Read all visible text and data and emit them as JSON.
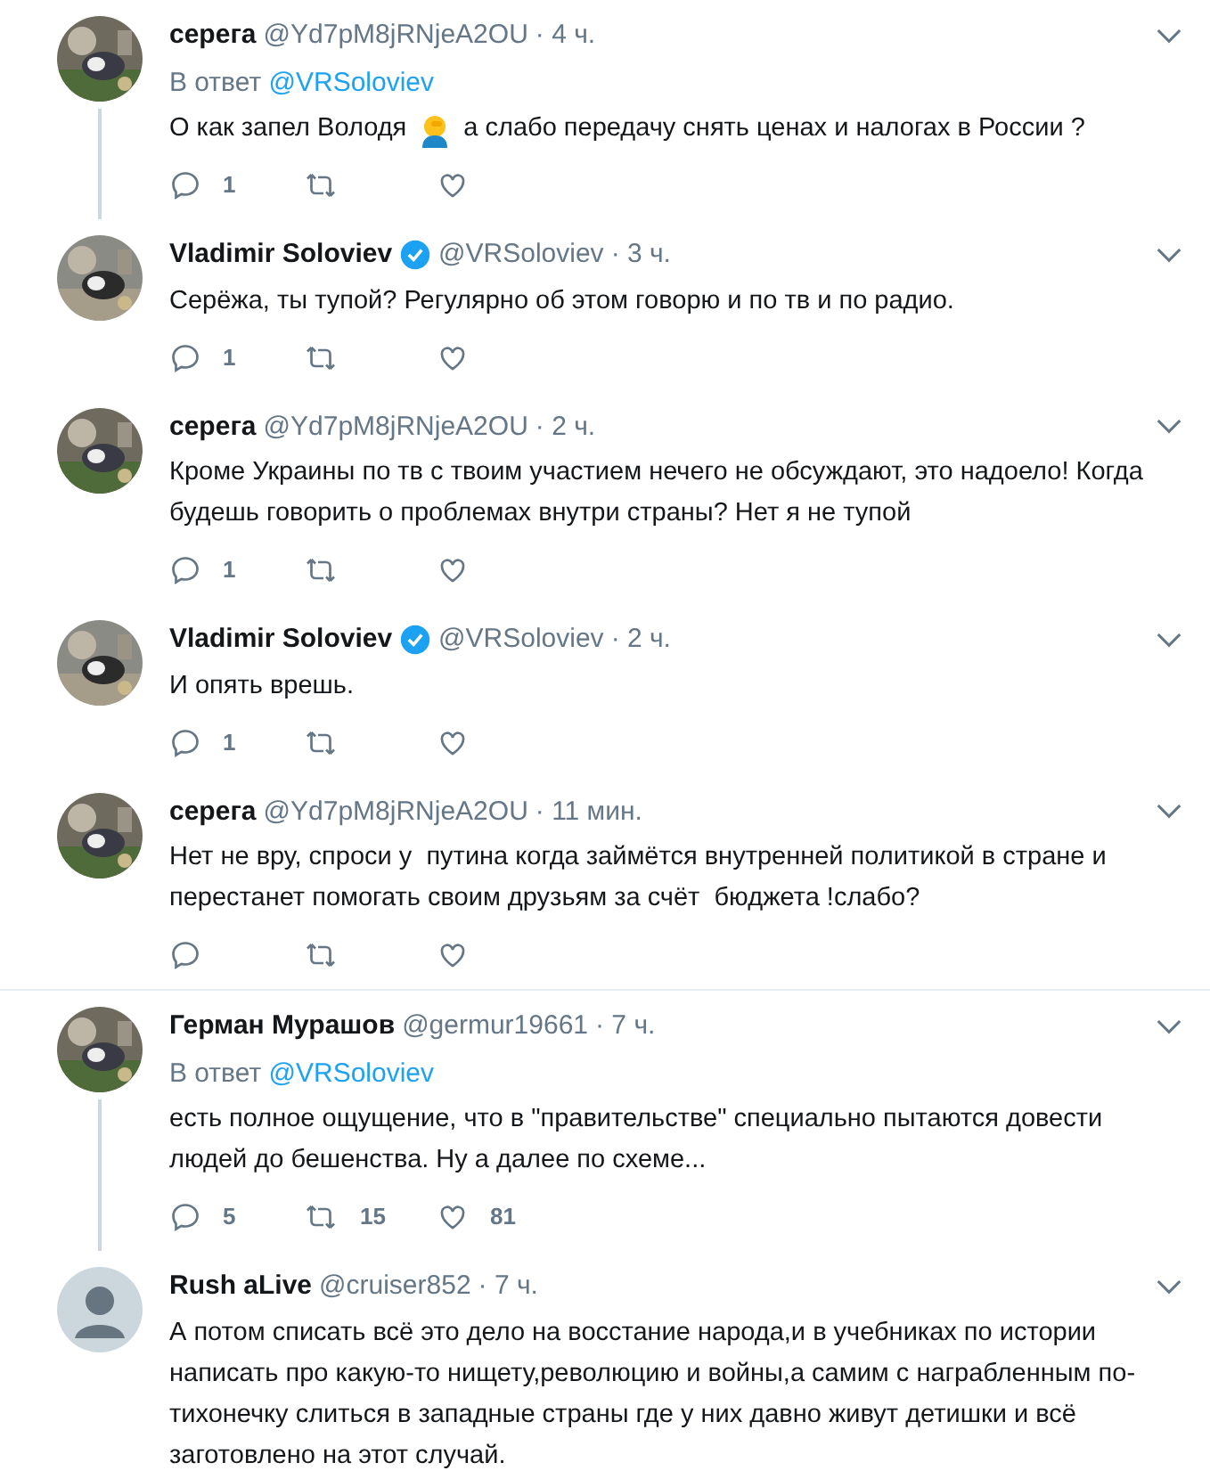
{
  "threads": [
    {
      "tweets": [
        {
          "name": "серега",
          "handle": "@Yd7pM8jRNjeA2OU",
          "time": "· 4 ч.",
          "verified": false,
          "default_avatar": false,
          "reply_label": "В ответ",
          "reply_to": "@VRSoloviev",
          "text": "О как запел Володя",
          "facepalm_emoji": true,
          "text_after": "а слабо передачу снять ценах и налогах в России ?",
          "thread_line": true,
          "replies": "1"
        },
        {
          "name": "Vladimir Soloviev",
          "handle": "@VRSoloviev",
          "time": "· 3 ч.",
          "verified": true,
          "default_avatar": false,
          "text": "Серёжа, ты тупой? Регулярно об этом говорю и по тв и по радио.",
          "thread_line": false,
          "replies": "1"
        },
        {
          "name": "серега",
          "handle": "@Yd7pM8jRNjeA2OU",
          "time": "· 2 ч.",
          "verified": false,
          "default_avatar": false,
          "text": "Кроме Украины по тв с твоим участием нечего не обсуждают, это надоело! Когда будешь говорить о проблемах внутри страны? Нет я не тупой",
          "thread_line": false,
          "replies": "1"
        },
        {
          "name": "Vladimir Soloviev",
          "handle": "@VRSoloviev",
          "time": "· 2 ч.",
          "verified": true,
          "default_avatar": false,
          "text": "И опять врешь.",
          "thread_line": false,
          "replies": "1"
        },
        {
          "name": "серега",
          "handle": "@Yd7pM8jRNjeA2OU",
          "time": "· 11 мин.",
          "verified": false,
          "default_avatar": false,
          "text": "Нет не вру, спроси у  путина когда займётся внутренней политикой в стране и перестанет помогать своим друзьям за счёт  бюджета !слабо?",
          "thread_line": false
        }
      ]
    },
    {
      "tweets": [
        {
          "name": "Герман Мурашов",
          "handle": "@germur19661",
          "time": "· 7 ч.",
          "verified": false,
          "default_avatar": false,
          "reply_label": "В ответ",
          "reply_to": "@VRSoloviev",
          "text": "есть полное ощущение, что в \"правительстве\" специально пытаются довести людей до бешенства. Ну а далее по схеме...",
          "thread_line": true,
          "replies": "5",
          "retweets": "15",
          "likes": "81"
        },
        {
          "name": "Rush aLive",
          "handle": "@cruiser852",
          "time": "· 7 ч.",
          "verified": false,
          "default_avatar": true,
          "text": "А потом списать всё это дело на восстание народа,и в учебниках по истории написать про какую-то нищету,революцию и войны,а самим с награбленным по-тихонечку слиться в западные страны где у них давно живут детишки и всё заготовлено на этот случай.",
          "thread_line": false
        }
      ]
    }
  ]
}
